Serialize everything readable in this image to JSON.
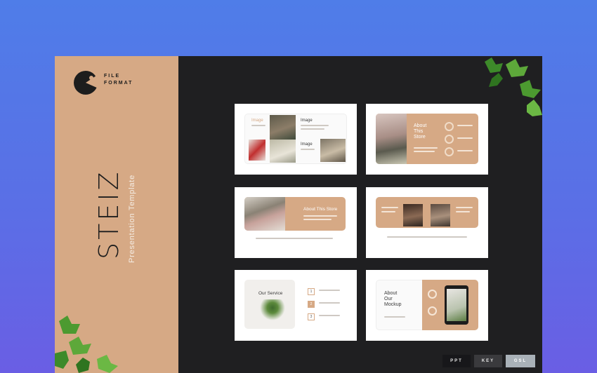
{
  "brand": {
    "file_format": "FILE\nFORMAT",
    "title": "STEIZ",
    "subtitle": "Presentation Template"
  },
  "slides": {
    "s1": {
      "label_a": "Image",
      "label_b": "Image",
      "label_c": "Image"
    },
    "s2": {
      "heading": "About\nThis\nStore"
    },
    "s3": {
      "heading": "About This Store"
    },
    "s5": {
      "heading": "Our Service",
      "n1": "1",
      "n2": "2",
      "n3": "3"
    },
    "s6": {
      "heading": "About\nOur\nMockup"
    }
  },
  "formats": {
    "ppt": "PPT",
    "key": "KEY",
    "gsl": "GSL"
  },
  "colors": {
    "accent": "#d6a985",
    "frame": "#1f1f21",
    "background_top": "#4f7de8",
    "background_bottom": "#6a5ee4"
  }
}
